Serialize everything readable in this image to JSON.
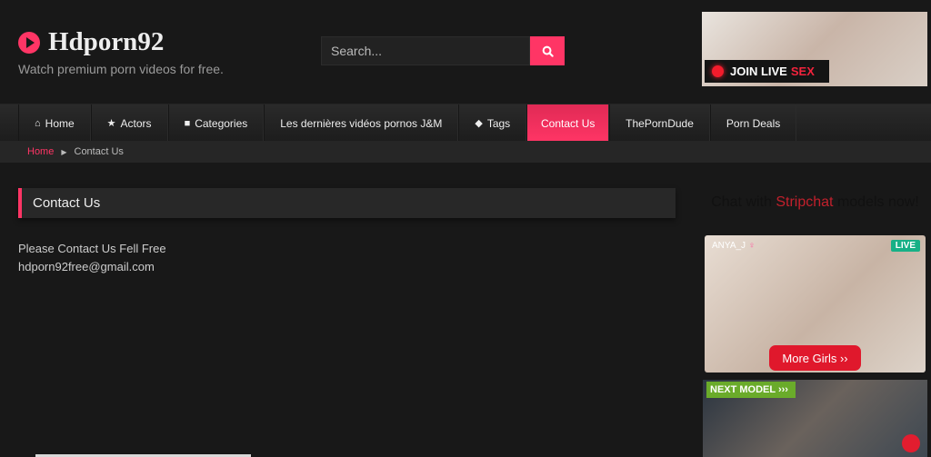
{
  "header": {
    "site_name": "Hdporn92",
    "tagline": "Watch premium porn videos for free.",
    "search": {
      "placeholder": "Search...",
      "value": ""
    },
    "ad_banner": {
      "label_main": "JOIN LIVE",
      "label_highlight": "SEX"
    }
  },
  "nav": {
    "items": [
      {
        "label": "Home",
        "icon": "home-icon"
      },
      {
        "label": "Actors",
        "icon": "star-icon"
      },
      {
        "label": "Categories",
        "icon": "folder-icon"
      },
      {
        "label": "Les dernières vidéos pornos J&M",
        "icon": ""
      },
      {
        "label": "Tags",
        "icon": "tags-icon"
      },
      {
        "label": "Contact Us",
        "icon": "",
        "active": true
      },
      {
        "label": "ThePornDude",
        "icon": ""
      },
      {
        "label": "Porn Deals",
        "icon": ""
      }
    ]
  },
  "breadcrumb": {
    "home": "Home",
    "current": "Contact Us"
  },
  "page": {
    "title": "Contact Us",
    "lines": [
      "Please Contact Us Fell Free",
      "hdporn92free@gmail.com"
    ]
  },
  "sidebar": {
    "title_pre": "Chat with",
    "title_brand": "Stripchat",
    "title_post": "models now!",
    "cam1": {
      "name": "ANYA_J",
      "live_badge": "LIVE",
      "button": "More Girls ››"
    },
    "cam2": {
      "badge": "NEXT MODEL ›››"
    }
  },
  "colors": {
    "accent": "#ff3565",
    "background": "#181818"
  }
}
